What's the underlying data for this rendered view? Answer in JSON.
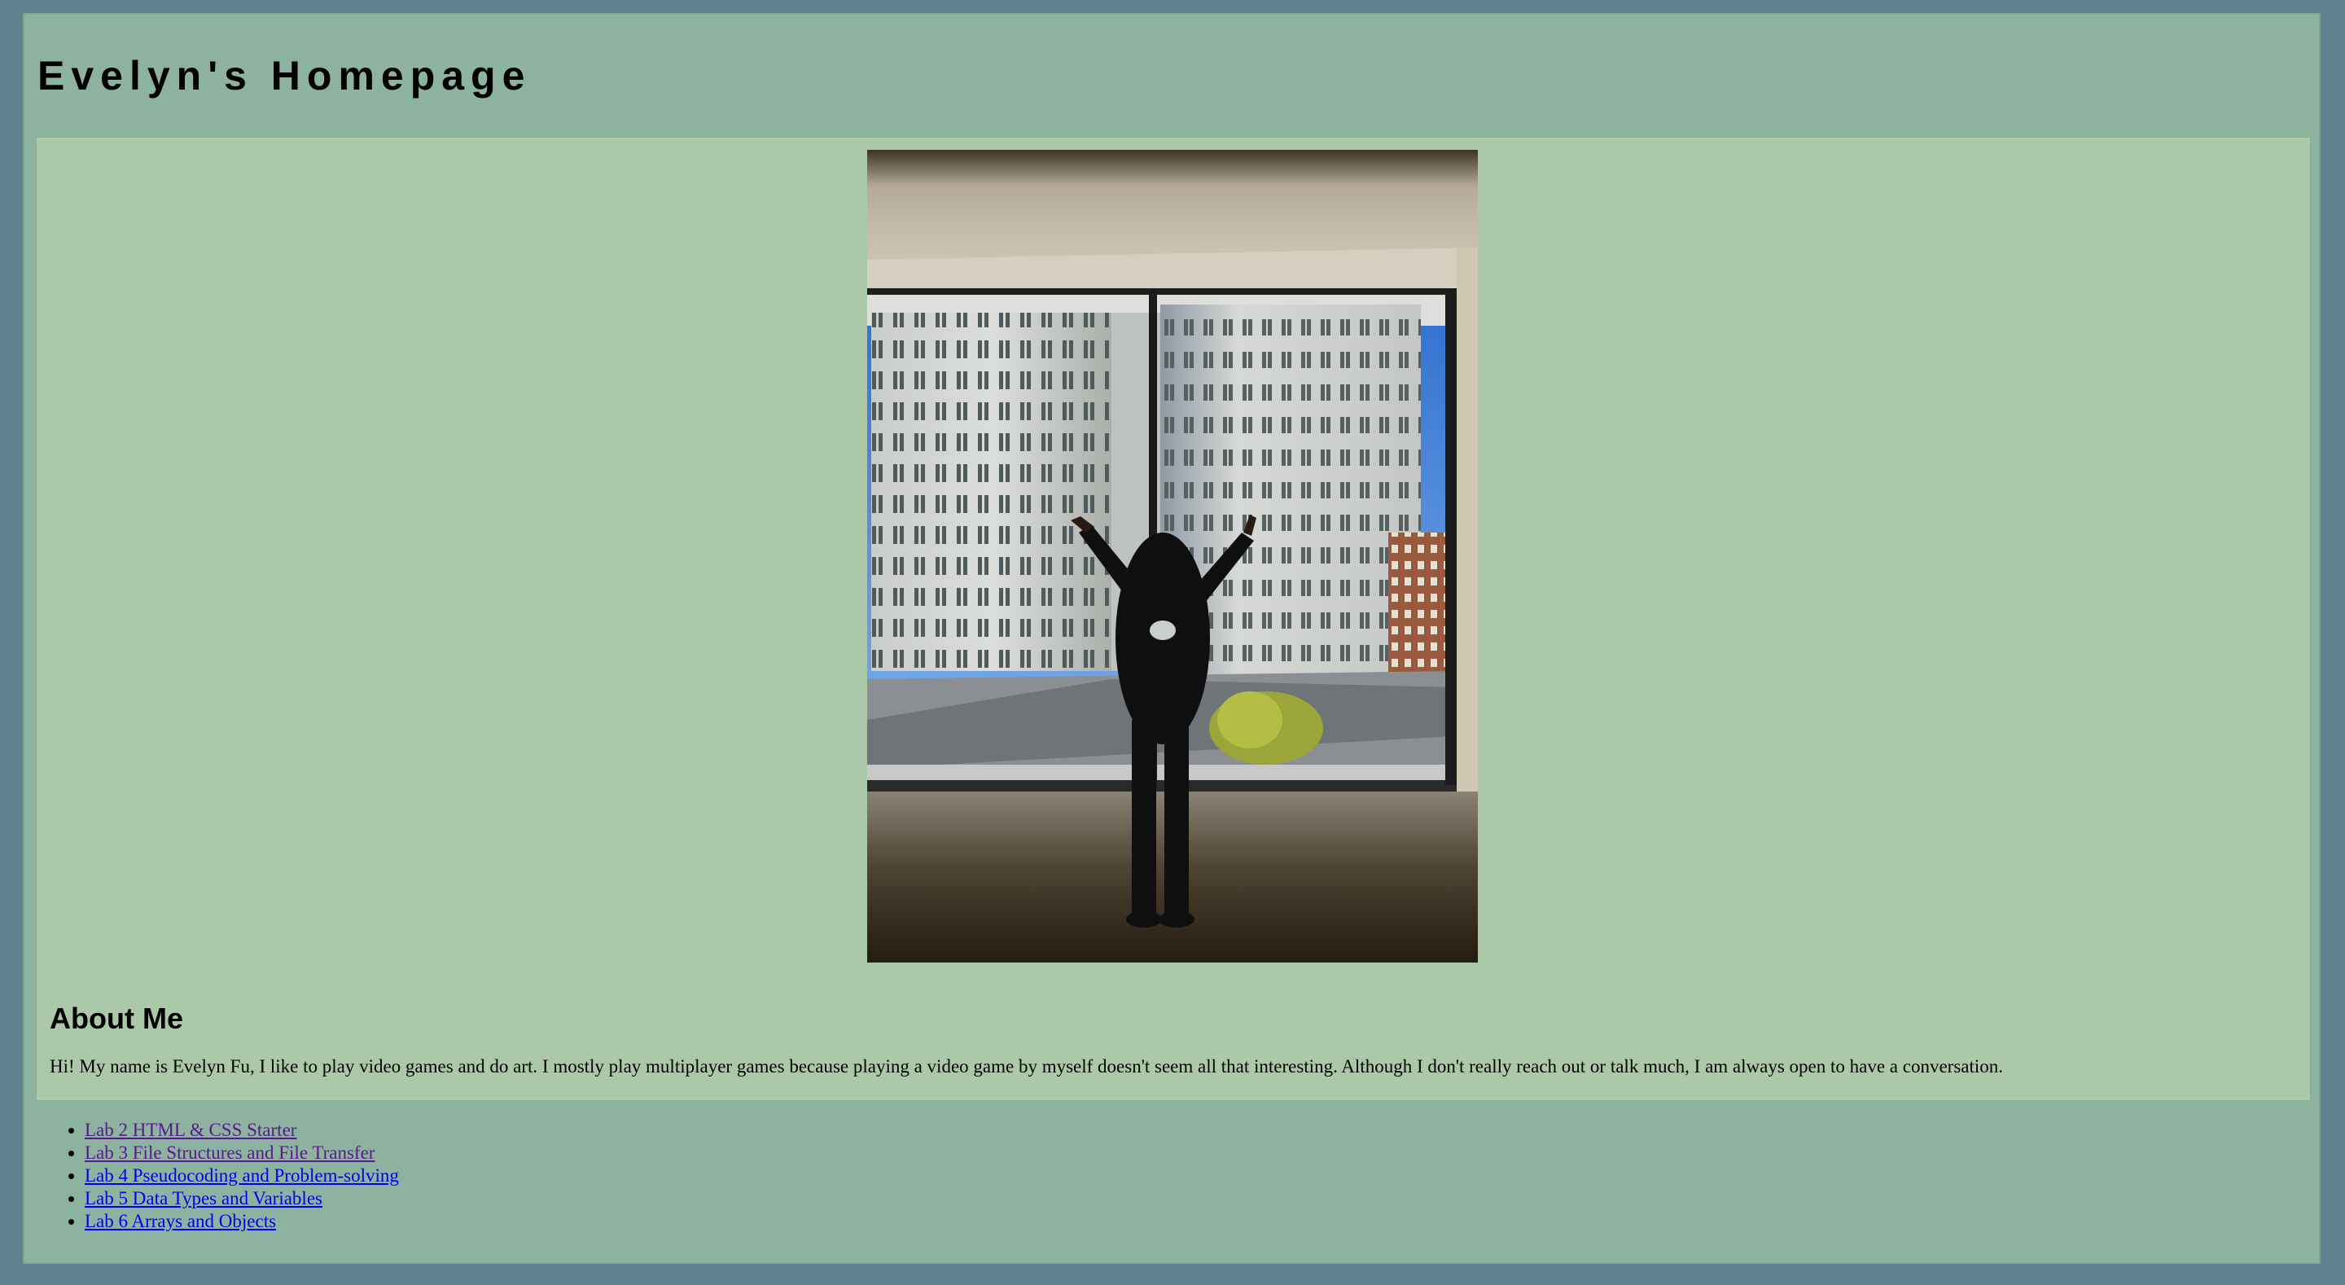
{
  "header": {
    "title": "Evelyn's Homepage"
  },
  "photo": {
    "alt": "Evelyn posing in front of a window overlooking city buildings"
  },
  "about": {
    "heading": "About Me",
    "text": "Hi! My name is Evelyn Fu, I like to play video games and do art. I mostly play multiplayer games because playing a video game by myself doesn't seem all that interesting. Although I don't really reach out or talk much, I am always open to have a conversation."
  },
  "labs": [
    {
      "label": "Lab 2 HTML & CSS Starter",
      "visited": true
    },
    {
      "label": "Lab 3 File Structures and File Transfer",
      "visited": true
    },
    {
      "label": "Lab 4 Pseudocoding and Problem-solving",
      "visited": false
    },
    {
      "label": "Lab 5 Data Types and Variables",
      "visited": false
    },
    {
      "label": "Lab 6 Arrays and Objects",
      "visited": false
    }
  ],
  "colors": {
    "outer_background": "#5e8290",
    "page_background": "#8db3a0",
    "content_background": "#abc9a8",
    "link": "#0000ee",
    "visited_link": "#551a8b"
  }
}
